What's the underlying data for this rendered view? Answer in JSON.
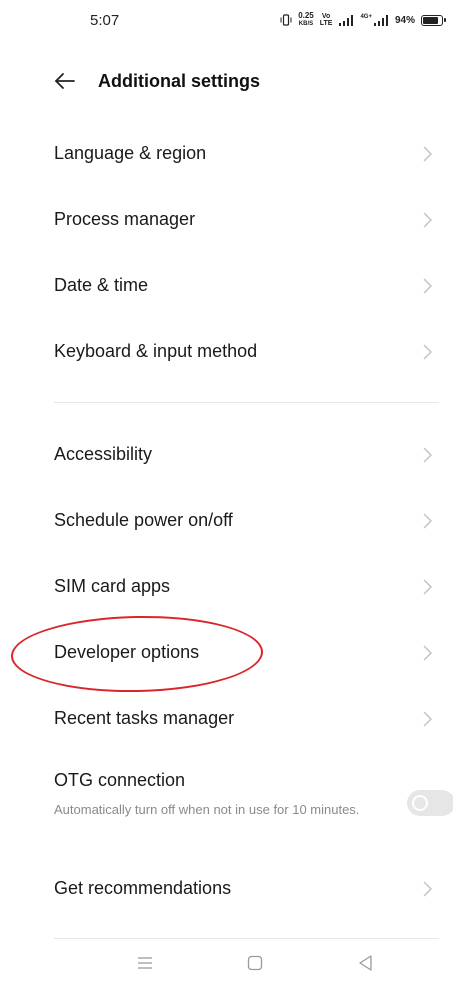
{
  "status_bar": {
    "time": "5:07",
    "speed_value": "0.25",
    "speed_unit": "KB/S",
    "volte_top": "Vo",
    "volte_bottom": "LTE",
    "network_type": "4G+",
    "battery": "94%"
  },
  "header": {
    "title": "Additional settings",
    "back_icon": "arrow-left-icon"
  },
  "items": [
    {
      "label": "Language & region"
    },
    {
      "label": "Process manager"
    },
    {
      "label": "Date & time"
    },
    {
      "label": "Keyboard & input method"
    },
    {
      "label": "Accessibility"
    },
    {
      "label": "Schedule power on/off"
    },
    {
      "label": "SIM card apps"
    },
    {
      "label": "Developer options"
    },
    {
      "label": "Recent tasks manager"
    },
    {
      "label": "OTG connection",
      "sublabel": "Automatically turn off when not in use for 10 minutes.",
      "toggle_on": false
    },
    {
      "label": "Get recommendations"
    }
  ],
  "annotation": {
    "highlighted_item": "Developer options",
    "color": "#d9262b"
  },
  "nav_bar": {
    "icons": [
      "menu-icon",
      "home-icon",
      "back-triangle-icon"
    ]
  }
}
